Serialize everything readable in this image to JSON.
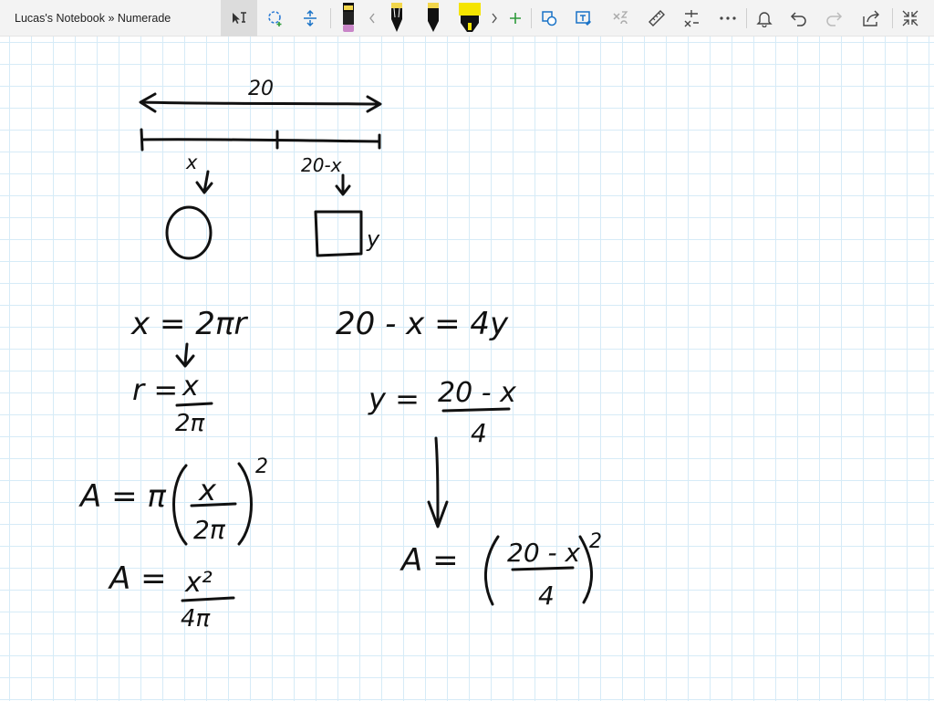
{
  "window": {
    "title": "Lucas's Notebook » Numerade"
  },
  "toolbar": {
    "icons": [
      "select-text-icon",
      "lasso-icon",
      "insert-space-icon",
      "pen-pink-icon",
      "chevron-left-icon",
      "pen-black-1-icon",
      "pen-black-2-icon",
      "highlighter-yellow-icon",
      "chevron-right-icon",
      "add-pen-icon",
      "ink-to-shape-icon",
      "ink-to-text-icon",
      "ink-to-math-icon",
      "ruler-icon",
      "math-icon",
      "more-icon",
      "notifications-icon",
      "undo-icon",
      "redo-icon",
      "share-icon",
      "fullscreen-icon"
    ],
    "colors": {
      "pink_pen": "#c985c8",
      "yellow_highlighter": "#f5e400",
      "add_green": "#2e9a3b",
      "accent_blue": "#1a73c7"
    }
  },
  "notes": {
    "top_length": "20",
    "segment_left": "x",
    "segment_right": "20-x",
    "square_side": "y",
    "eq1": "x = 2πr",
    "eq2_lhs": "r =",
    "eq2_num": "x",
    "eq2_den": "2π",
    "eq3_lhs": "A = π",
    "eq3_num": "x",
    "eq3_den": "2π",
    "eq3_exp": "2",
    "eq4_lhs": "A =",
    "eq4_num": "x²",
    "eq4_den": "4π",
    "eq5": "20 - x = 4y",
    "eq6_lhs": "y =",
    "eq6_num": "20 - x",
    "eq6_den": "4",
    "eq7_lhs": "A =",
    "eq7_num": "20 - x",
    "eq7_den": "4",
    "eq7_exp": "2"
  }
}
